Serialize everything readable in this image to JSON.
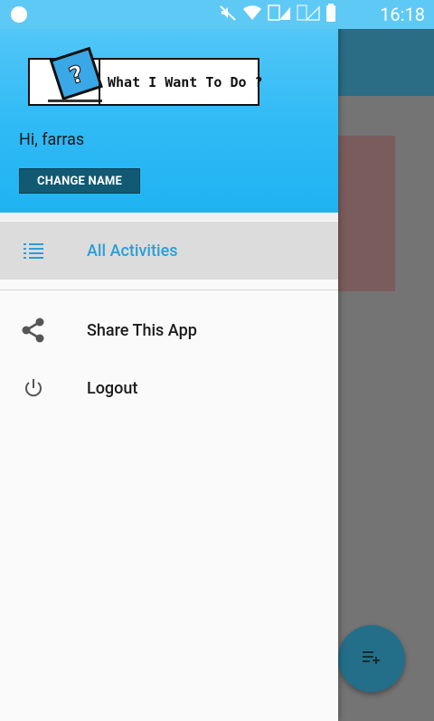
{
  "status_bar": {
    "time": "16:18",
    "icons": [
      "dot-icon",
      "mute-icon",
      "wifi-icon",
      "signal-icon",
      "signal-off-icon",
      "battery-icon"
    ]
  },
  "drawer": {
    "logo_text": "What I Want To Do ?",
    "greeting": "Hi, farras",
    "change_name_label": "CHANGE NAME",
    "items": [
      {
        "label": "All Activities",
        "icon": "list-icon",
        "selected": true
      },
      {
        "label": "Share This App",
        "icon": "share-icon",
        "selected": false
      },
      {
        "label": "Logout",
        "icon": "power-icon",
        "selected": false
      }
    ]
  },
  "fab": {
    "icon": "playlist-add-icon"
  },
  "colors": {
    "header_gradient_top": "#5ccaf8",
    "header_gradient_bottom": "#1fb3f2",
    "accent": "#2a9fd8",
    "button": "#125a73",
    "toolbar": "#2a6d84"
  }
}
